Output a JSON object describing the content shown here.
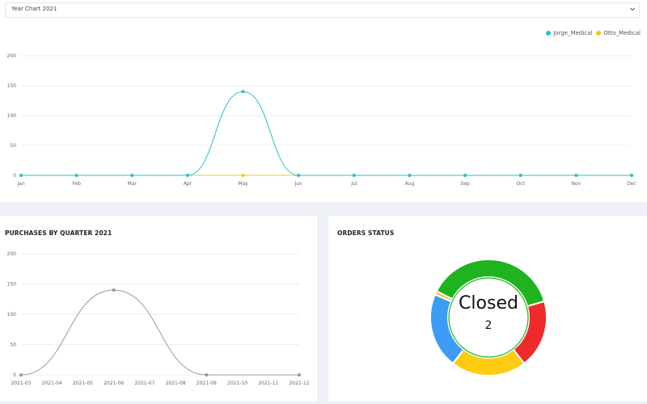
{
  "year_select": {
    "value": "Year Chart 2021"
  },
  "legend": [
    {
      "name": "Jorge_Medical",
      "color": "#2cc0c9"
    },
    {
      "name": "Otto_Medical",
      "color": "#f5c518"
    }
  ],
  "purchases_card": {
    "title": "PURCHASES BY QUARTER 2021"
  },
  "orders_card": {
    "title": "ORDERS STATUS",
    "center_title": "Closed",
    "center_value": "2"
  },
  "chart_data": [
    {
      "type": "line",
      "categories": [
        "Jan",
        "Feb",
        "Mar",
        "Apr",
        "May",
        "Jun",
        "Jul",
        "Aug",
        "Sep",
        "Oct",
        "Nov",
        "Dec"
      ],
      "yticks": [
        "0",
        "50",
        "100",
        "150",
        "200"
      ],
      "ylim": [
        0,
        200
      ],
      "legend_position": "top-right",
      "grid": true,
      "series": [
        {
          "name": "Jorge_Medical",
          "color": "#2cc0c9",
          "values": [
            0,
            0,
            0,
            0,
            140,
            0,
            0,
            0,
            0,
            0,
            0,
            0
          ]
        },
        {
          "name": "Otto_Medical",
          "color": "#f5c518",
          "values": [
            0,
            0,
            0,
            0,
            0,
            0,
            0,
            0,
            0,
            0,
            0,
            0
          ]
        }
      ]
    },
    {
      "type": "line",
      "categories": [
        "2021-03",
        "2021-04",
        "2021-05",
        "2021-06",
        "2021-07",
        "2021-08",
        "2021-09",
        "2021-10",
        "2021-11",
        "2021-12"
      ],
      "yticks": [
        "0",
        "50",
        "100",
        "150",
        "200"
      ],
      "ylim": [
        0,
        200
      ],
      "grid": true,
      "series": [
        {
          "color": "#999999",
          "values": [
            0,
            null,
            null,
            140,
            null,
            null,
            0,
            null,
            null,
            0
          ]
        }
      ]
    },
    {
      "type": "pie",
      "donut": true,
      "values": [
        38,
        19,
        21,
        21,
        1
      ],
      "colors": [
        "#1fb31f",
        "#ee2a2a",
        "#ffcc11",
        "#3d9cf5",
        "#f1c419"
      ]
    }
  ]
}
